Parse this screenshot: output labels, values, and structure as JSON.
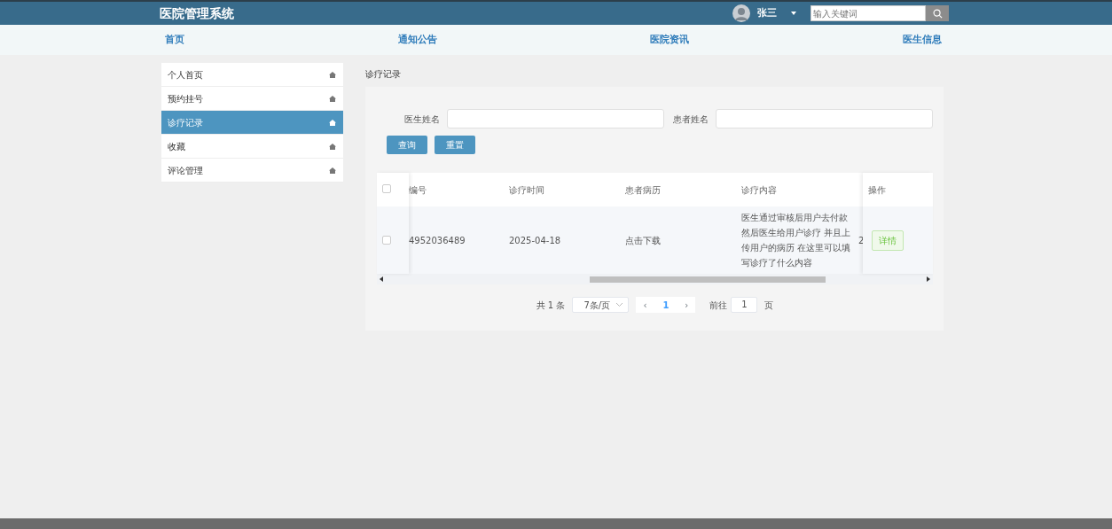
{
  "header": {
    "title": "医院管理系统",
    "user": "张三",
    "search": {
      "placeholder": "输入关键词"
    }
  },
  "nav": [
    {
      "label": "首页"
    },
    {
      "label": "通知公告"
    },
    {
      "label": "医院资讯"
    },
    {
      "label": "医生信息"
    }
  ],
  "sidebar": {
    "items": [
      {
        "label": "个人首页",
        "selected": false
      },
      {
        "label": "预约挂号",
        "selected": false
      },
      {
        "label": "诊疗记录",
        "selected": true
      },
      {
        "label": "收藏",
        "selected": false
      },
      {
        "label": "评论管理",
        "selected": false
      }
    ]
  },
  "page_title": "诊疗记录",
  "filters": [
    {
      "label": "医生姓名"
    },
    {
      "label": "患者姓名"
    }
  ],
  "buttons": [
    "查询",
    "重置"
  ],
  "table": {
    "all_checked": false,
    "columns": [
      "编号",
      "诊疗时间",
      "患者病历",
      "诊疗内容",
      "操作"
    ],
    "rows": [
      {
        "checked": false,
        "id": "4952036489",
        "date": "2025-04-18",
        "record": "点击下载",
        "content": "医生通过审核后用户去付款然后医生给用户诊疗 并且上传用户的病历 在这里可以填写诊疗了什么内容",
        "column_5": "2",
        "action": "详情"
      }
    ]
  },
  "pagination": {
    "total": "共 1 条",
    "page_size": "7条/页",
    "prev": "‹",
    "page": "1",
    "next": "›",
    "goto_label": "前往",
    "goto_value": "1",
    "goto_suffix": "页"
  }
}
